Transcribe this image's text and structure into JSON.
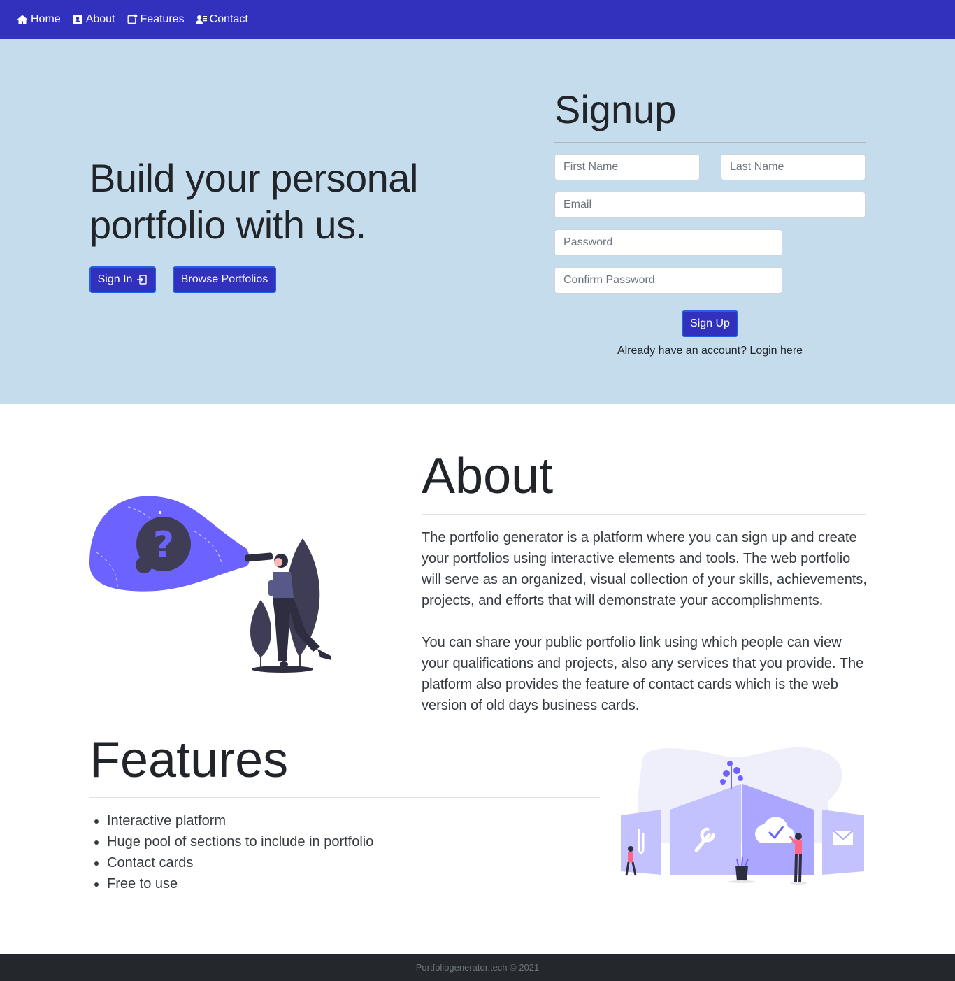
{
  "nav": {
    "items": [
      {
        "label": "Home",
        "icon": "home-icon"
      },
      {
        "label": "About",
        "icon": "person-badge-icon"
      },
      {
        "label": "Features",
        "icon": "features-icon"
      },
      {
        "label": "Contact",
        "icon": "contact-list-icon"
      }
    ]
  },
  "hero": {
    "title": "Build your personal portfolio with us.",
    "signin_label": "Sign In",
    "browse_label": "Browse Portfolios"
  },
  "signup": {
    "title": "Signup",
    "first_name_placeholder": "First Name",
    "last_name_placeholder": "Last Name",
    "email_placeholder": "Email",
    "password_placeholder": "Password",
    "confirm_password_placeholder": "Confirm Password",
    "submit_label": "Sign Up",
    "login_prompt": "Already have an account?",
    "login_link": "Login here"
  },
  "about": {
    "title": "About",
    "paragraph1": "The portfolio generator is a platform where you can sign up and create your portfolios using interactive elements and tools. The web portfolio will serve as an organized, visual collection of your skills, achievements, projects, and efforts that will demonstrate your accomplishments.",
    "paragraph2": "You can share your public portfolio link using which people can view your qualifications and projects, also any services that you provide. The platform also provides the feature of contact cards which is the web version of old days business cards."
  },
  "features": {
    "title": "Features",
    "items": [
      "Interactive platform",
      "Huge pool of sections to include in portfolio",
      "Contact cards",
      "Free to use"
    ]
  },
  "footer": {
    "text": "Portfoliogenerator.tech © 2021"
  },
  "colors": {
    "navbar": "#3131bd",
    "hero_bg": "#c5dcec",
    "accent": "#6c63ff",
    "footer_bg": "#24282c"
  }
}
